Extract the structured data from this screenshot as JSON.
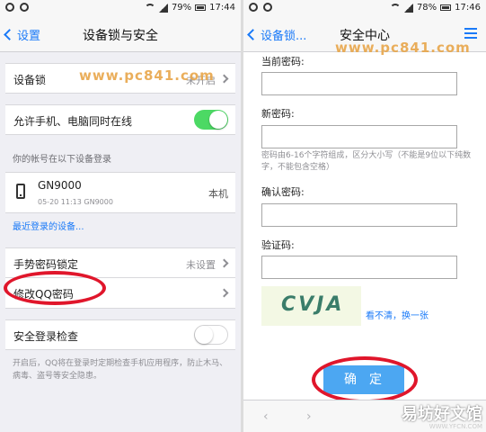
{
  "left": {
    "status": {
      "battery": "79%",
      "time": "17:44"
    },
    "nav": {
      "back_label": "设置",
      "title": "设备锁与安全"
    },
    "watermark": "www.pc841.com",
    "device_lock": {
      "label": "设备锁",
      "value": "未开启"
    },
    "allow_online": {
      "label": "允许手机、电脑同时在线",
      "on": true
    },
    "devices_section": "你的帐号在以下设备登录",
    "device": {
      "name": "GN9000",
      "sub": "05-20 11:13  GN9000",
      "type": "本机"
    },
    "recent_link": "最近登录的设备...",
    "gesture_lock": {
      "label": "手势密码锁定",
      "value": "未设置"
    },
    "change_pwd": {
      "label": "修改QQ密码"
    },
    "login_check": {
      "label": "安全登录检查",
      "on": false
    },
    "login_check_desc": "开启后，QQ将在登录时定期检查手机应用程序，防止木马、病毒、盗号等安全隐患。"
  },
  "right": {
    "status": {
      "battery": "78%",
      "time": "17:46"
    },
    "nav": {
      "back_label": "设备锁...",
      "title": "安全中心"
    },
    "watermark": "www.pc841.com",
    "current_pwd_label": "当前密码:",
    "new_pwd_label": "新密码:",
    "new_pwd_hint": "密码由6-16个字符组成，区分大小写（不能是9位以下纯数字，不能包含空格）",
    "confirm_pwd_label": "确认密码:",
    "captcha_label": "验证码:",
    "captcha_text": "CVJA",
    "captcha_refresh": "看不清，换一张",
    "confirm_button": "确定",
    "bottom": {
      "back": "‹",
      "forward": "›"
    },
    "brand": "易坊好文馆",
    "brand_sub": "WWW.YFCN.COM"
  },
  "colors": {
    "accent": "#1a7af8",
    "toggle_on": "#4cd964",
    "annotation": "#e0162b",
    "button": "#4ca7f2"
  }
}
